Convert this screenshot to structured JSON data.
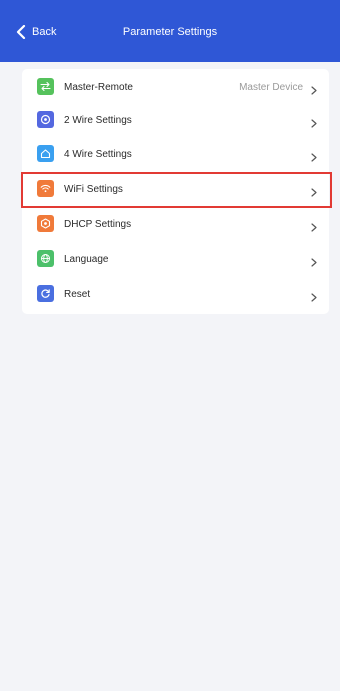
{
  "header": {
    "back_label": "Back",
    "title": "Parameter Settings",
    "color": "#2f57d6"
  },
  "settings": {
    "items": [
      {
        "label": "Master-Remote",
        "value": "Master Device",
        "icon": "swap-arrows-icon",
        "color": "#55c25c"
      },
      {
        "label": "2 Wire Settings",
        "value": "",
        "icon": "settings-circle-icon",
        "color": "#5468e0"
      },
      {
        "label": "4 Wire Settings",
        "value": "",
        "icon": "house-icon",
        "color": "#3aa0f0"
      },
      {
        "label": "WiFi Settings",
        "value": "",
        "icon": "wifi-icon",
        "color": "#f07a3a"
      },
      {
        "label": "DHCP Settings",
        "value": "",
        "icon": "hexagon-network-icon",
        "color": "#f07a3a"
      },
      {
        "label": "Language",
        "value": "",
        "icon": "globe-icon",
        "color": "#4cc06a"
      },
      {
        "label": "Reset",
        "value": "",
        "icon": "reset-icon",
        "color": "#4a6fe0"
      }
    ],
    "highlight_color": "#e23a34"
  }
}
